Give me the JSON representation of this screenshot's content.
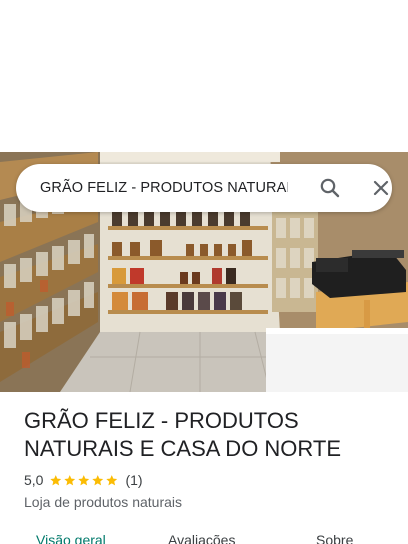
{
  "search": {
    "query": "GRÃO FELIZ - PRODUTOS NATURAIS E CASA DO NORTE"
  },
  "place": {
    "title": "GRÃO FELIZ - PRODUTOS NATURAIS E CASA DO NORTE",
    "rating": "5,0",
    "stars": 5,
    "review_count": "(1)",
    "category": "Loja de produtos naturais"
  },
  "tabs": [
    {
      "label": "Visão geral",
      "active": true
    },
    {
      "label": "Avaliações",
      "active": false
    },
    {
      "label": "Sobre",
      "active": false
    }
  ],
  "colors": {
    "star": "#fbbc04",
    "active_tab": "#00796b",
    "icon": "#5f6368"
  },
  "icons": [
    "search-icon",
    "close-icon",
    "star-icon"
  ]
}
